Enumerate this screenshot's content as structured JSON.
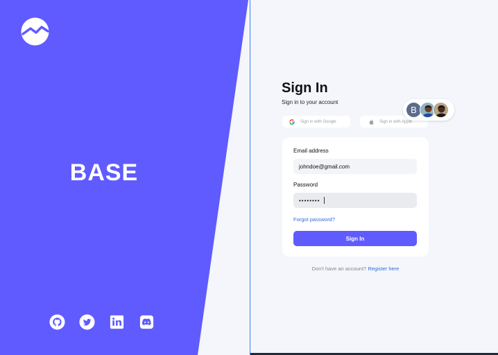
{
  "brand": {
    "name": "BASE",
    "accent_color": "#605bff",
    "logo_icon": "wave-logo-icon"
  },
  "socials": [
    {
      "name": "github",
      "icon": "github-icon"
    },
    {
      "name": "twitter",
      "icon": "twitter-icon"
    },
    {
      "name": "linkedin",
      "icon": "linkedin-icon"
    },
    {
      "name": "discord",
      "icon": "discord-icon"
    }
  ],
  "signin": {
    "title": "Sign In",
    "subtitle": "Sign in to your account",
    "google_label": "Sign in with Google",
    "apple_label": "Sign in with Apple",
    "avatar_initial": "B",
    "email": {
      "label": "Email address",
      "value": "johndoe@gmail.com"
    },
    "password": {
      "label": "Password",
      "value": "••••••••"
    },
    "forgot_label": "Forgot password?",
    "submit_label": "Sign In",
    "register_prompt": "Don't have an account?",
    "register_link": "Register here"
  }
}
